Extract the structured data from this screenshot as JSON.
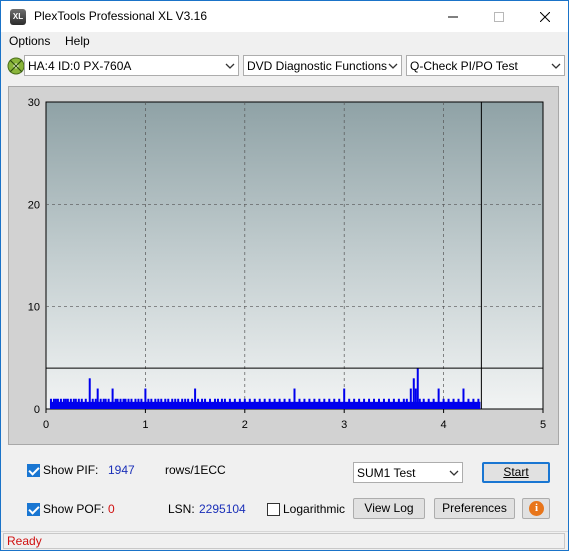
{
  "window": {
    "title": "PlexTools Professional XL V3.16",
    "icon": "XL"
  },
  "titlebar": {
    "minimize_icon": "minimize-icon",
    "maximize_icon": "maximize-icon",
    "close_icon": "close-icon"
  },
  "menu": {
    "options": "Options",
    "help": "Help"
  },
  "toolbar": {
    "drive": "HA:4 ID:0  PX-760A",
    "function": "DVD Diagnostic Functions",
    "test": "Q-Check PI/PO Test"
  },
  "chart_data": {
    "type": "bar",
    "x_ticks": [
      "0",
      "1",
      "2",
      "3",
      "4",
      "5"
    ],
    "y_ticks": [
      "0",
      "10",
      "20",
      "30"
    ],
    "xlim": [
      0,
      5
    ],
    "ylim": [
      0,
      30
    ],
    "grid": true,
    "threshold_y": 4,
    "end_marker_x": 4.38,
    "bar_color": "#0000ee",
    "pif_series": [
      [
        0.05,
        1
      ],
      [
        0.08,
        1
      ],
      [
        0.1,
        1
      ],
      [
        0.12,
        1
      ],
      [
        0.15,
        1
      ],
      [
        0.18,
        1
      ],
      [
        0.2,
        1
      ],
      [
        0.22,
        1
      ],
      [
        0.25,
        1
      ],
      [
        0.28,
        1
      ],
      [
        0.3,
        1
      ],
      [
        0.33,
        1
      ],
      [
        0.36,
        1
      ],
      [
        0.4,
        1
      ],
      [
        0.44,
        3
      ],
      [
        0.47,
        1
      ],
      [
        0.5,
        1
      ],
      [
        0.52,
        2
      ],
      [
        0.55,
        1
      ],
      [
        0.58,
        1
      ],
      [
        0.6,
        1
      ],
      [
        0.63,
        1
      ],
      [
        0.67,
        2
      ],
      [
        0.7,
        1
      ],
      [
        0.72,
        1
      ],
      [
        0.75,
        1
      ],
      [
        0.78,
        1
      ],
      [
        0.8,
        1
      ],
      [
        0.83,
        1
      ],
      [
        0.86,
        1
      ],
      [
        0.9,
        1
      ],
      [
        0.93,
        1
      ],
      [
        0.96,
        1
      ],
      [
        1.0,
        2
      ],
      [
        1.03,
        1
      ],
      [
        1.06,
        1
      ],
      [
        1.1,
        1
      ],
      [
        1.13,
        1
      ],
      [
        1.16,
        1
      ],
      [
        1.2,
        1
      ],
      [
        1.23,
        1
      ],
      [
        1.27,
        1
      ],
      [
        1.3,
        1
      ],
      [
        1.33,
        1
      ],
      [
        1.37,
        1
      ],
      [
        1.4,
        1
      ],
      [
        1.43,
        1
      ],
      [
        1.47,
        1
      ],
      [
        1.5,
        2
      ],
      [
        1.53,
        1
      ],
      [
        1.57,
        1
      ],
      [
        1.6,
        1
      ],
      [
        1.65,
        1
      ],
      [
        1.7,
        1
      ],
      [
        1.73,
        1
      ],
      [
        1.77,
        1
      ],
      [
        1.8,
        1
      ],
      [
        1.85,
        1
      ],
      [
        1.9,
        1
      ],
      [
        1.95,
        1
      ],
      [
        2.0,
        1
      ],
      [
        2.05,
        1
      ],
      [
        2.1,
        1
      ],
      [
        2.15,
        1
      ],
      [
        2.2,
        1
      ],
      [
        2.25,
        1
      ],
      [
        2.3,
        1
      ],
      [
        2.35,
        1
      ],
      [
        2.4,
        1
      ],
      [
        2.45,
        1
      ],
      [
        2.5,
        2
      ],
      [
        2.55,
        1
      ],
      [
        2.6,
        1
      ],
      [
        2.65,
        1
      ],
      [
        2.7,
        1
      ],
      [
        2.75,
        1
      ],
      [
        2.8,
        1
      ],
      [
        2.85,
        1
      ],
      [
        2.9,
        1
      ],
      [
        2.95,
        1
      ],
      [
        3.0,
        2
      ],
      [
        3.05,
        1
      ],
      [
        3.1,
        1
      ],
      [
        3.15,
        1
      ],
      [
        3.2,
        1
      ],
      [
        3.25,
        1
      ],
      [
        3.3,
        1
      ],
      [
        3.35,
        1
      ],
      [
        3.4,
        1
      ],
      [
        3.45,
        1
      ],
      [
        3.5,
        1
      ],
      [
        3.55,
        1
      ],
      [
        3.6,
        1
      ],
      [
        3.63,
        1
      ],
      [
        3.67,
        2
      ],
      [
        3.7,
        3
      ],
      [
        3.72,
        2
      ],
      [
        3.74,
        4
      ],
      [
        3.76,
        1
      ],
      [
        3.8,
        1
      ],
      [
        3.85,
        1
      ],
      [
        3.9,
        1
      ],
      [
        3.95,
        2
      ],
      [
        4.0,
        1
      ],
      [
        4.05,
        1
      ],
      [
        4.1,
        1
      ],
      [
        4.15,
        1
      ],
      [
        4.2,
        2
      ],
      [
        4.25,
        1
      ],
      [
        4.3,
        1
      ],
      [
        4.35,
        1
      ]
    ]
  },
  "controls": {
    "show_pif_label": "Show PIF:",
    "pif_value": "1947",
    "rows_label": "rows/1ECC",
    "show_pof_label": "Show POF:",
    "pof_value": "0",
    "lsn_label": "LSN:",
    "lsn_value": "2295104",
    "logarithmic_label": "Logarithmic",
    "test_select": "SUM1 Test",
    "start_button": "Start",
    "viewlog_button": "View Log",
    "preferences_button": "Preferences",
    "info_icon": "i"
  },
  "status": {
    "text": "Ready"
  }
}
